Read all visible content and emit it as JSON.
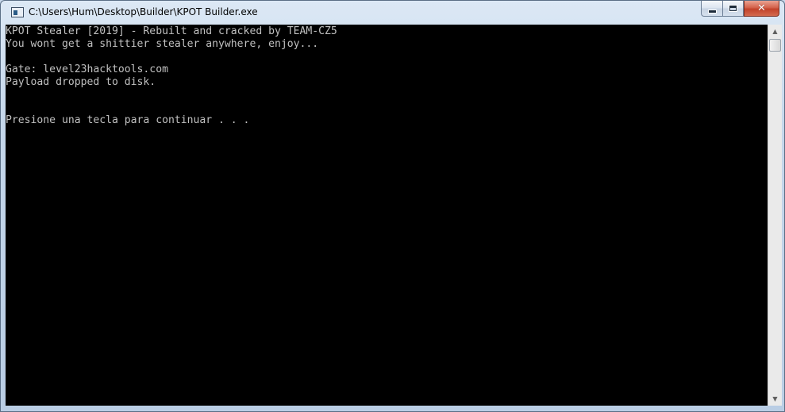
{
  "window": {
    "title": "C:\\Users\\Hum\\Desktop\\Builder\\KPOT Builder.exe",
    "controls": {
      "minimize_icon": "minimize-icon",
      "maximize_icon": "maximize-icon",
      "close_icon": "close-icon",
      "close_glyph": "✕"
    }
  },
  "console": {
    "lines": [
      "KPOT Stealer [2019] - Rebuilt and cracked by TEAM-CZ5",
      "You wont get a shittier stealer anywhere, enjoy...",
      "",
      "Gate: level23hacktools.com",
      "Payload dropped to disk.",
      "",
      "",
      "Presione una tecla para continuar . . ."
    ],
    "background": "#000000",
    "text_color": "#c0c0c0"
  },
  "scrollbar": {
    "up_glyph": "▲",
    "down_glyph": "▼"
  }
}
